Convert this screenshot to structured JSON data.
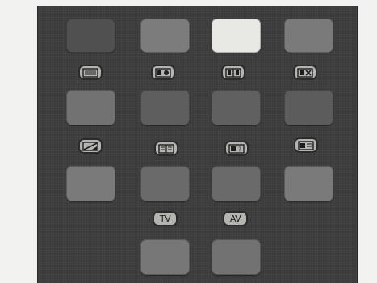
{
  "remote": {
    "colors": {
      "body": "#3b3b3b",
      "key_dark": "#545454",
      "key_mid": "#7a7a7a",
      "key_bright": "#e6e6e2",
      "icon_button": "#b4b4b0"
    },
    "icon_buttons": [
      {
        "name": "teletext-icon",
        "label": ""
      },
      {
        "name": "teletext-mix-icon",
        "label": ""
      },
      {
        "name": "teletext-size-icon",
        "label": ""
      },
      {
        "name": "teletext-cancel-icon",
        "label": ""
      },
      {
        "name": "picture-off-icon",
        "label": ""
      },
      {
        "name": "teletext-subpage-icon",
        "label": ""
      },
      {
        "name": "teletext-reveal-icon",
        "label": ""
      },
      {
        "name": "teletext-index-icon",
        "label": ""
      }
    ],
    "text_buttons": [
      {
        "name": "tv-button",
        "label": "TV"
      },
      {
        "name": "av-button",
        "label": "AV"
      }
    ]
  }
}
